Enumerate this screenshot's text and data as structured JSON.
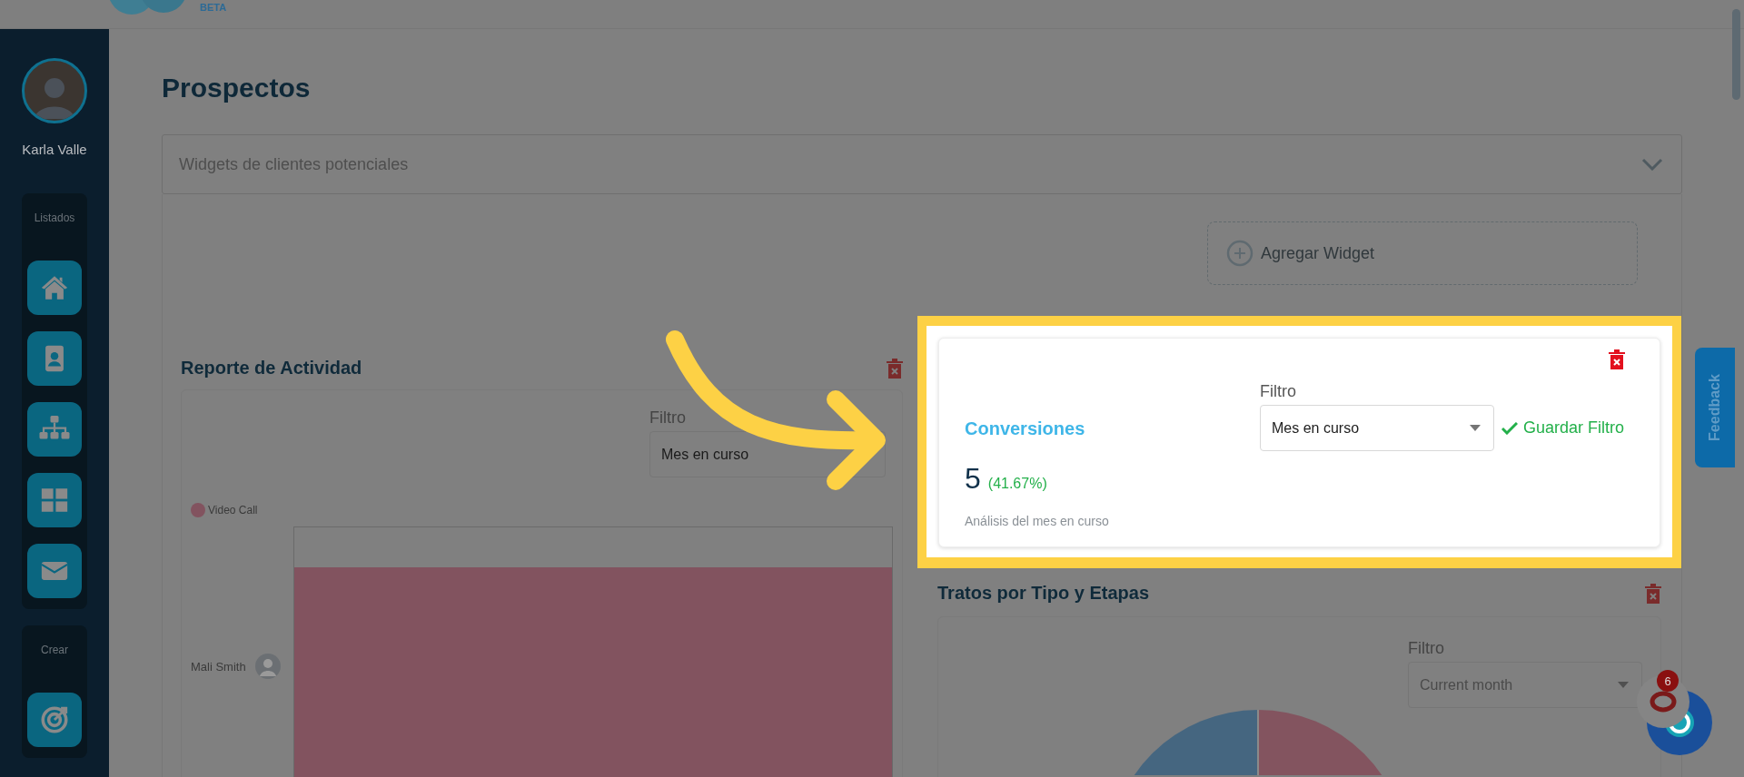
{
  "header": {
    "badge": "BETA"
  },
  "user": {
    "name": "Karla Valle"
  },
  "sidebar": {
    "sections": [
      {
        "title": "Listados"
      },
      {
        "title": "Crear"
      }
    ]
  },
  "page": {
    "title": "Prospectos"
  },
  "accordion": {
    "label": "Widgets de clientes potenciales"
  },
  "add_widget": {
    "label": "Agregar Widget"
  },
  "widgets": [
    {
      "kind": "activity",
      "title": "Reporte de Actividad",
      "filter_label": "Filtro",
      "filter_value": "Mes en curso",
      "legend": [
        {
          "label": "Video Call",
          "color": "#82535f"
        }
      ],
      "rows": [
        {
          "label": "Mali Smith"
        }
      ]
    },
    {
      "kind": "stat",
      "highlighted": true,
      "title": "Conversiones",
      "filter_label": "Filtro",
      "filter_value": "Mes en curso",
      "save_label": "Guardar Filtro",
      "value": "5",
      "percent": "(41.67%)",
      "caption": "Análisis del mes en curso"
    },
    {
      "kind": "pie",
      "title": "Tratos por Tipo y Etapas",
      "filter_label": "Filtro",
      "filter_value": "Current month"
    }
  ],
  "feedback": {
    "label": "Feedback"
  },
  "chat": {
    "badge": "6"
  }
}
